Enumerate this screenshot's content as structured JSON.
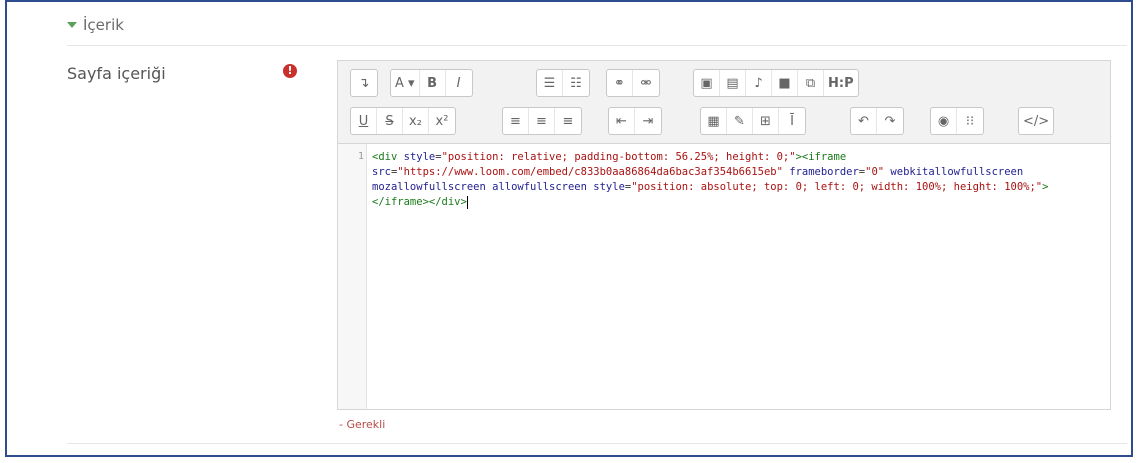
{
  "section": {
    "title": "İçerik"
  },
  "field": {
    "label": "Sayfa içeriği",
    "required_icon": "exclamation-icon",
    "required_note": "- Gerekli"
  },
  "toolbar": {
    "row1": [
      [
        "enter-icon",
        "↵"
      ],
      [
        "font-size-icon",
        "A ▾"
      ],
      [
        "bold-icon",
        "B"
      ],
      [
        "italic-icon",
        "I"
      ],
      [
        "unordered-list-icon",
        "☰"
      ],
      [
        "ordered-list-icon",
        "☷"
      ],
      [
        "link-icon",
        "⚭"
      ],
      [
        "unlink-icon",
        "⚮"
      ],
      [
        "image-icon",
        "▣"
      ],
      [
        "media-icon",
        "▤"
      ],
      [
        "record-audio-icon",
        "🎙"
      ],
      [
        "record-video-icon",
        "■"
      ],
      [
        "manage-files-icon",
        "⧉"
      ],
      [
        "h5p-icon",
        "H:P"
      ]
    ],
    "row2": [
      [
        "underline-icon",
        "U"
      ],
      [
        "strikethrough-icon",
        "S"
      ],
      [
        "subscript-icon",
        "x₂"
      ],
      [
        "superscript-icon",
        "x²"
      ],
      [
        "align-left-icon",
        "≡"
      ],
      [
        "align-center-icon",
        "≡"
      ],
      [
        "align-right-icon",
        "≡"
      ],
      [
        "decrease-indent-icon",
        "⇤"
      ],
      [
        "increase-indent-icon",
        "⇥"
      ],
      [
        "equation-icon",
        "▦"
      ],
      [
        "special-char-icon",
        "✎"
      ],
      [
        "table-icon",
        "⊞"
      ],
      [
        "clear-format-icon",
        "Ī"
      ],
      [
        "undo-icon",
        "↶"
      ],
      [
        "redo-icon",
        "↷"
      ],
      [
        "accessibility-icon",
        "◉"
      ],
      [
        "screenreader-icon",
        "⁝⁝"
      ],
      [
        "html-icon",
        "</>"
      ]
    ]
  },
  "editor": {
    "line_number": "1",
    "code": "<div style=\"position: relative; padding-bottom: 56.25%; height: 0;\"><iframe src=\"https://www.loom.com/embed/c833b0aa86864da6bac3af354b6615eb\" frameborder=\"0\" webkitallowfullscreen mozallowfullscreen allowfullscreen style=\"position: absolute; top: 0; left: 0; width: 100%; height: 100%;\"></iframe></div>"
  }
}
